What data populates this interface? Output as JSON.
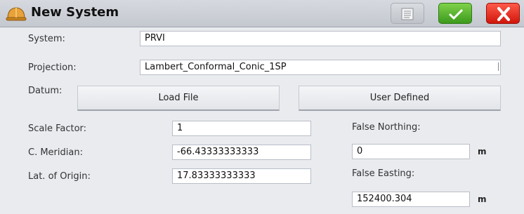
{
  "window": {
    "title": "New System"
  },
  "icons": {
    "app": "hard-hat-icon",
    "menu": "menu-list-icon",
    "ok": "checkmark-icon",
    "close": "close-x-icon"
  },
  "colors": {
    "ok": "#3c9a1c",
    "close": "#d0160b",
    "titlebar": "#c8ccd2"
  },
  "form": {
    "system_label": "System:",
    "system_value": "PRVI",
    "projection_label": "Projection:",
    "projection_value": "Lambert_Conformal_Conic_1SP",
    "datum_label": "Datum:",
    "load_file_label": "Load File",
    "user_defined_label": "User Defined",
    "scale_factor_label": "Scale Factor:",
    "scale_factor_value": "1",
    "c_meridian_label": "C. Meridian:",
    "c_meridian_value": "-66.43333333333",
    "lat_origin_label": "Lat. of Origin:",
    "lat_origin_value": "17.83333333333",
    "false_northing_label": "False Northing:",
    "false_northing_value": "0",
    "false_northing_unit": "m",
    "false_easting_label": "False Easting:",
    "false_easting_value": "152400.304",
    "false_easting_unit": "m"
  }
}
